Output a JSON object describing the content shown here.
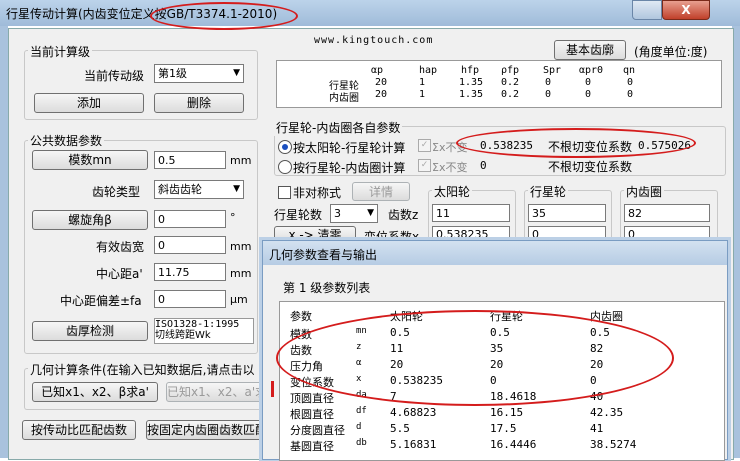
{
  "window": {
    "title": "行星传动计算(内齿变位定义按GB/T3374.1-2010)",
    "close": "X"
  },
  "watermark": "www.kingtouch.com",
  "current_stage": {
    "group": "当前计算级",
    "stage_label": "当前传动级",
    "stage_value": "第1级",
    "add": "添加",
    "delete": "删除"
  },
  "base_profile": {
    "button": "基本齿廓",
    "unit_note": "(角度单位:度)"
  },
  "profile_table": {
    "headers": [
      "αp",
      "hap",
      "hfp",
      "ρfp",
      "Spr",
      "αpr0",
      "qn"
    ],
    "rows": [
      {
        "name": "行星轮",
        "values": [
          "20",
          "1",
          "1.35",
          "0.2",
          "0",
          "0",
          "0"
        ]
      },
      {
        "name": "内齿圈",
        "values": [
          "20",
          "1",
          "1.35",
          "0.2",
          "0",
          "0",
          "0"
        ]
      }
    ]
  },
  "common": {
    "group": "公共数据参数",
    "module_btn": "模数mn",
    "module_value": "0.5",
    "module_unit": "mm",
    "gear_type_label": "齿轮类型",
    "gear_type_value": "斜齿齿轮",
    "helix_btn": "螺旋角β",
    "helix_value": "0",
    "helix_unit": "°",
    "face_label": "有效齿宽",
    "face_value": "0",
    "face_unit": "mm",
    "center_label": "中心距a'",
    "center_value": "11.75",
    "center_unit": "mm",
    "dev_label": "中心距偏差±fa",
    "dev_value": "0",
    "dev_unit": "μm",
    "tooth_btn": "齿厚检测",
    "tooth_value_1": "ISO1328-1:1995",
    "tooth_value_2": "切线跨距Wk"
  },
  "geometry": {
    "group": "几何计算条件(在输入已知数据后,请点击以",
    "btn1": "已知x1、x2、β求a'",
    "btn2": "已知x1、x2、a'求"
  },
  "bottom": {
    "btn1": "按传动比匹配齿数",
    "btn2": "按固定内齿圈齿数匹配"
  },
  "shift": {
    "group": "行星轮-内齿圈各自参数",
    "radio1": "按太阳轮-行星轮计算",
    "radio2": "按行星轮-内齿圈计算",
    "sigma1_label": "Σx不变",
    "sigma1_value": "0.538235",
    "sigma2_label": "Σx不变",
    "sigma2_value": "0",
    "root1_label": "不根切变位系数",
    "root1_value": "0.575026",
    "root2_label": "不根切变位系数"
  },
  "gear": {
    "nonsym": "非对称式",
    "detail": "详情",
    "planet_count_label": "行星轮数",
    "planet_count": "3",
    "x_btn": "x -> 清零",
    "teeth_label": "齿数z",
    "shift_label": "变位系数x",
    "sun": {
      "title": "太阳轮",
      "z": "11",
      "x": "0.538235"
    },
    "planet": {
      "title": "行星轮",
      "z": "35",
      "x": "0"
    },
    "ring": {
      "title": "内齿圈",
      "z": "82",
      "x": "0"
    }
  },
  "child": {
    "title": "几何参数查看与输出",
    "subtitle": "第 1 级参数列表",
    "headers": [
      "参数",
      "太阳轮",
      "行星轮",
      "内齿圈"
    ],
    "rows": [
      {
        "name": "模数",
        "sym": "mn",
        "v": [
          "0.5",
          "0.5",
          "0.5"
        ]
      },
      {
        "name": "齿数",
        "sym": "z",
        "v": [
          "11",
          "35",
          "82"
        ]
      },
      {
        "name": "压力角",
        "sym": "α",
        "v": [
          "20",
          "20",
          "20"
        ]
      },
      {
        "name": "变位系数",
        "sym": "x",
        "v": [
          "0.538235",
          "0",
          "0"
        ]
      },
      {
        "name": "顶圆直径",
        "sym": "da",
        "v": [
          "7",
          "18.4618",
          "40"
        ]
      },
      {
        "name": "根圆直径",
        "sym": "df",
        "v": [
          "4.68823",
          "16.15",
          "42.35"
        ]
      },
      {
        "name": "分度圆直径",
        "sym": "d",
        "v": [
          "5.5",
          "17.5",
          "41"
        ]
      },
      {
        "name": "基圆直径",
        "sym": "db",
        "v": [
          "5.16831",
          "16.4446",
          "38.5274"
        ]
      }
    ]
  },
  "colors": {
    "title_bar": "#a9c2dd",
    "annotation": "#d41c1c"
  }
}
